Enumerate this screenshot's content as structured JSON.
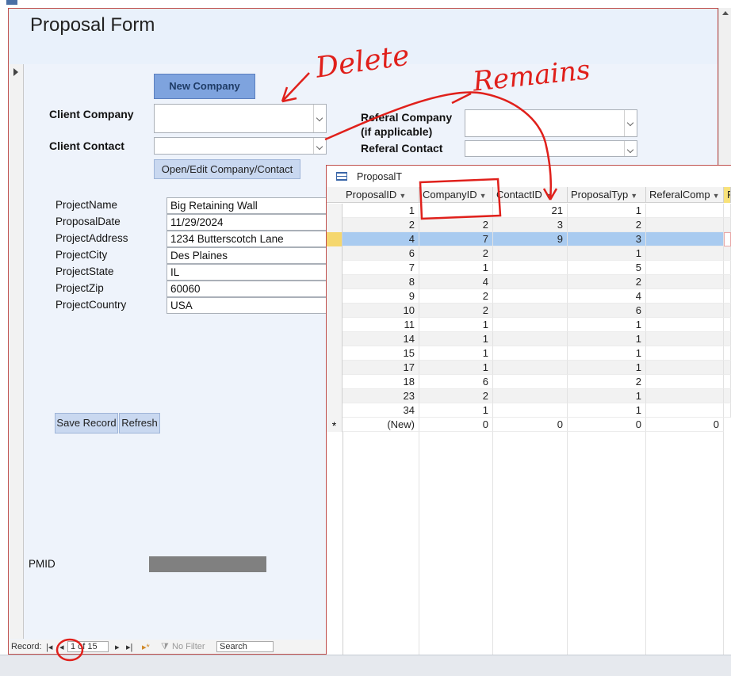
{
  "form": {
    "title": "Proposal Form",
    "new_company_label": "New Company",
    "client_company_label": "Client Company",
    "client_contact_label": "Client Contact",
    "referal_company_label": "Referal Company",
    "referal_company_sub": "(if applicable)",
    "referal_contact_label": "Referal Contact",
    "open_edit_label": "Open/Edit Company/Contact",
    "fields": [
      {
        "label": "ProjectName",
        "value": "Big Retaining Wall"
      },
      {
        "label": "ProposalDate",
        "value": "11/29/2024"
      },
      {
        "label": "ProjectAddress",
        "value": "1234 Butterscotch Lane"
      },
      {
        "label": "ProjectCity",
        "value": "Des Plaines"
      },
      {
        "label": "ProjectState",
        "value": "IL"
      },
      {
        "label": "ProjectZip",
        "value": "60060"
      },
      {
        "label": "ProjectCountry",
        "value": "USA"
      }
    ],
    "save_label": "Save Record",
    "refresh_label": "Refresh",
    "pmid_label": "PMID"
  },
  "navbar": {
    "record_label": "Record:",
    "position": "1 of 15",
    "filter_label": "No Filter",
    "search_label": "Search"
  },
  "sheet": {
    "tab_label": "ProposalT",
    "columns": [
      "ProposalID",
      "CompanyID",
      "ContactID",
      "ProposalTyp",
      "ReferalComp",
      "R"
    ],
    "rows": [
      [
        "1",
        "",
        "21",
        "1",
        ""
      ],
      [
        "2",
        "2",
        "3",
        "2",
        ""
      ],
      [
        "4",
        "7",
        "9",
        "3",
        ""
      ],
      [
        "6",
        "2",
        "",
        "1",
        ""
      ],
      [
        "7",
        "1",
        "",
        "5",
        ""
      ],
      [
        "8",
        "4",
        "",
        "2",
        ""
      ],
      [
        "9",
        "2",
        "",
        "4",
        ""
      ],
      [
        "10",
        "2",
        "",
        "6",
        ""
      ],
      [
        "11",
        "1",
        "",
        "1",
        ""
      ],
      [
        "14",
        "1",
        "",
        "1",
        ""
      ],
      [
        "15",
        "1",
        "",
        "1",
        ""
      ],
      [
        "17",
        "1",
        "",
        "1",
        ""
      ],
      [
        "18",
        "6",
        "",
        "2",
        ""
      ],
      [
        "23",
        "2",
        "",
        "1",
        ""
      ],
      [
        "34",
        "1",
        "",
        "1",
        ""
      ]
    ],
    "new_row": [
      "(New)",
      "0",
      "0",
      "0",
      "0"
    ],
    "new_row_marker": "*"
  },
  "annotations": {
    "delete_text": "Delete",
    "remains_text": "Remains",
    "ink_color": "#e0201b"
  }
}
